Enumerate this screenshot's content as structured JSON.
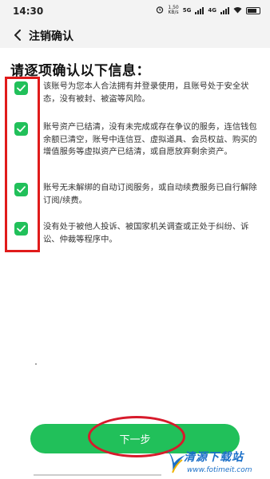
{
  "status_bar": {
    "time": "14:30",
    "net_speed_value": "1.50",
    "net_speed_unit": "KB/s",
    "signal_label": "5G",
    "signal_label_2": "4G"
  },
  "header": {
    "title": "注销确认"
  },
  "heading": "请逐项确认以下信息：",
  "items": [
    {
      "text": "该账号为您本人合法拥有并登录使用，且账号处于安全状态，没有被封、被盗等风险。",
      "checked": true
    },
    {
      "text": "账号资产已结清，没有未完成或存在争议的服务，连信钱包余额已清空，账号中连信豆、虚拟道具、会员权益、购买的增值服务等虚拟资产已结清，或自愿放弃剩余资产。",
      "checked": true
    },
    {
      "text": "账号无未解绑的自动订阅服务，或自动续费服务已自行解除订阅/续费。",
      "checked": true
    },
    {
      "text": "没有处于被他人投诉、被国家机关调查或正处于纠纷、诉讼、仲裁等程序中。",
      "checked": true
    }
  ],
  "next_button": "下一步",
  "watermark": {
    "title": "清源下载站",
    "url": "www.fotimeit.com"
  },
  "colors": {
    "accent_green": "#21c05a",
    "annotation_red": "#e01b1b",
    "watermark_blue": "#1a6fc8"
  }
}
